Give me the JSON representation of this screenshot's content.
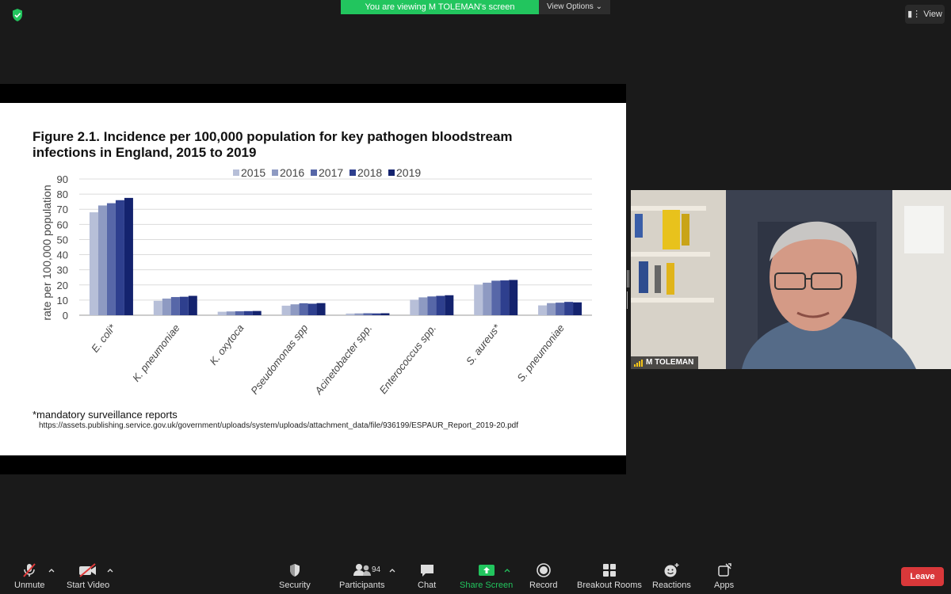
{
  "topbar": {
    "banner_text": "You are viewing M TOLEMAN's screen",
    "view_options_label": "View Options",
    "view_label": "View"
  },
  "slide": {
    "title": "Figure 2.1. Incidence per 100,000 population for key pathogen bloodstream infections in England, 2015 to 2019",
    "footnote": "*mandatory surveillance reports",
    "source_url": "https://assets.publishing.service.gov.uk/government/uploads/system/uploads/attachment_data/file/936199/ESPAUR_Report_2019-20.pdf"
  },
  "chart_data": {
    "type": "bar",
    "title": "Figure 2.1. Incidence per 100,000 population for key pathogen bloodstream infections in England, 2015 to 2019",
    "xlabel": "",
    "ylabel": "rate per 100,000 population",
    "ylim": [
      0,
      90
    ],
    "yticks": [
      0,
      10,
      20,
      30,
      40,
      50,
      60,
      70,
      80,
      90
    ],
    "grid": true,
    "legend_position": "top",
    "categories": [
      "E. coli*",
      "K. pneumoniae",
      "K. oxytoca",
      "Pseudomonas spp",
      "Acinetobacter spp.",
      "Enterococcus spp.",
      "S. aureus*",
      "S. pneumoniae"
    ],
    "series": [
      {
        "name": "2015",
        "color": "#b7bfd8",
        "values": [
          68,
          9.5,
          2.3,
          6.3,
          1.1,
          10.2,
          20.2,
          6.5
        ]
      },
      {
        "name": "2016",
        "color": "#8e9ac2",
        "values": [
          72.5,
          11,
          2.5,
          7.2,
          1.2,
          11.8,
          21.5,
          8
        ]
      },
      {
        "name": "2017",
        "color": "#5767a8",
        "values": [
          74,
          12,
          2.6,
          7.9,
          1.3,
          12.4,
          22.8,
          8.3
        ]
      },
      {
        "name": "2018",
        "color": "#2e3f8e",
        "values": [
          76,
          12.2,
          2.7,
          7.6,
          1.2,
          12.8,
          23,
          8.8
        ]
      },
      {
        "name": "2019",
        "color": "#14236e",
        "values": [
          77.5,
          12.8,
          2.8,
          8,
          1.3,
          13.2,
          23.3,
          8.5
        ]
      }
    ]
  },
  "video": {
    "participant_name": "M TOLEMAN"
  },
  "toolbar": {
    "unmute": "Unmute",
    "start_video": "Start Video",
    "security": "Security",
    "participants": "Participants",
    "participants_count": "94",
    "chat": "Chat",
    "share_screen": "Share Screen",
    "record": "Record",
    "breakout_rooms": "Breakout Rooms",
    "reactions": "Reactions",
    "apps": "Apps",
    "leave": "Leave"
  },
  "colors": {
    "accent_green": "#22c55e",
    "leave_red": "#d9383a",
    "background": "#1a1a1a"
  }
}
